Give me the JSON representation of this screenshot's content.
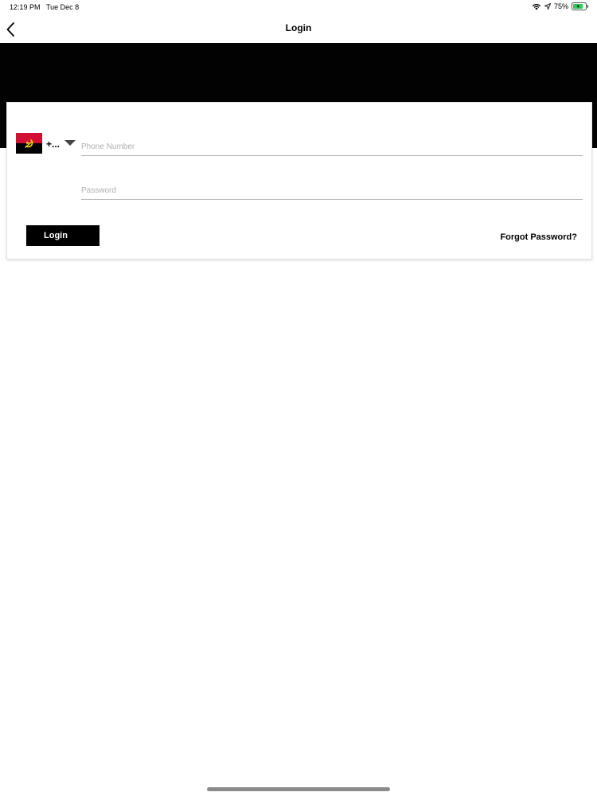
{
  "status_bar": {
    "time": "12:19 PM",
    "date": "Tue Dec 8",
    "battery": "75%",
    "icons": [
      "wifi-icon",
      "location-icon",
      "battery-icon"
    ]
  },
  "nav": {
    "title": "Login",
    "back_icon": "chevron-left-icon"
  },
  "login_form": {
    "country_flag": "angola-flag-icon",
    "country_code": "+...",
    "phone_placeholder": "Phone Number",
    "phone_value": "",
    "password_placeholder": "Password",
    "password_value": "",
    "login_label": "Login",
    "forgot_label": "Forgot Password?"
  },
  "colors": {
    "hero_band": "#020203",
    "button_bg": "#000000",
    "flag_red": "#d21034",
    "flag_black": "#000000",
    "flag_yellow": "#f9d616"
  }
}
